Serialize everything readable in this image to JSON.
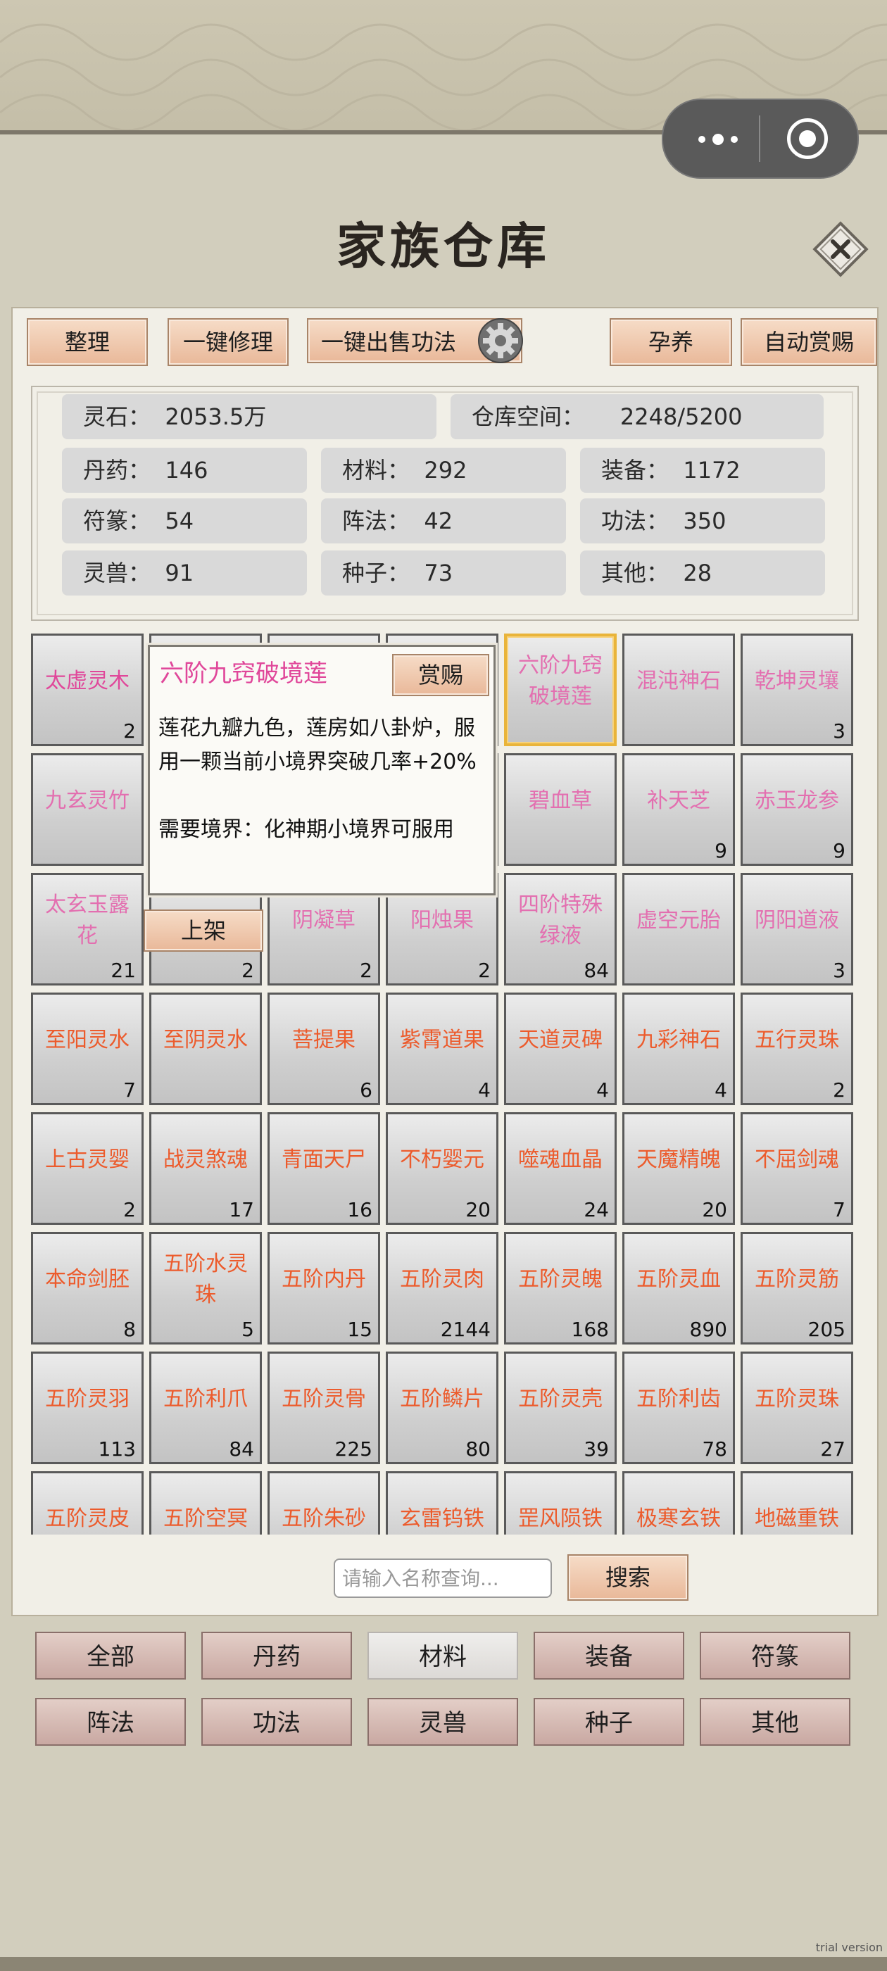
{
  "header": {
    "title": "家族仓库"
  },
  "toolbar": {
    "sort": "整理",
    "repair_all": "一键修理",
    "sell_skills": "一键出售功法",
    "nurture": "孕养",
    "auto_reward": "自动赏赐"
  },
  "stats": {
    "spirit_stone": "灵石：  2053.5万",
    "storage": "仓库空间：     2248/5200",
    "pills": "丹药：  146",
    "materials": "材料：  292",
    "equipment": "装备：  1172",
    "talismans": "符篆：  54",
    "formations": "阵法：  42",
    "skills": "功法：  350",
    "beasts": "灵兽：  91",
    "seeds": "种子：  73",
    "other": "其他：  28"
  },
  "tooltip": {
    "title": "六阶九窍破境莲",
    "reward_btn": "赏赐",
    "desc": "莲花九瓣九色，莲房如八卦炉，服用一颗当前小境界突破几率+20%",
    "requirement": "需要境界：化神期小境界可服用",
    "shelve_btn": "上架"
  },
  "grid": {
    "items": [
      {
        "name": "太虚灵木",
        "count": "2",
        "color": "pink"
      },
      {
        "name": "",
        "count": "",
        "color": "pink"
      },
      {
        "name": "",
        "count": "",
        "color": "pink"
      },
      {
        "name": "",
        "count": "",
        "color": "pink"
      },
      {
        "name": "六阶九窍破境莲",
        "count": "",
        "color": "pinklight",
        "selected": true
      },
      {
        "name": "混沌神石",
        "count": "",
        "color": "pinklight"
      },
      {
        "name": "乾坤灵壤",
        "count": "3",
        "color": "pinklight"
      },
      {
        "name": "九玄灵竹",
        "count": "",
        "color": "pinklight"
      },
      {
        "name": "",
        "count": "",
        "color": "pinklight"
      },
      {
        "name": "",
        "count": "",
        "color": "pinklight"
      },
      {
        "name": "",
        "count": "",
        "color": "pinklight"
      },
      {
        "name": "碧血草",
        "count": "",
        "color": "pinklight"
      },
      {
        "name": "补天芝",
        "count": "9",
        "color": "pinklight"
      },
      {
        "name": "赤玉龙参",
        "count": "9",
        "color": "pinklight"
      },
      {
        "name": "太玄玉露花",
        "count": "21",
        "color": "pinklight"
      },
      {
        "name": "",
        "count": "2",
        "color": "pinklight"
      },
      {
        "name": "阴凝草",
        "count": "2",
        "color": "pinklight"
      },
      {
        "name": "阳烛果",
        "count": "2",
        "color": "pinklight"
      },
      {
        "name": "四阶特殊绿液",
        "count": "84",
        "color": "pinklight"
      },
      {
        "name": "虚空元胎",
        "count": "",
        "color": "pinklight"
      },
      {
        "name": "阴阳道液",
        "count": "3",
        "color": "pinklight"
      },
      {
        "name": "至阳灵水",
        "count": "7",
        "color": "orange"
      },
      {
        "name": "至阴灵水",
        "count": "",
        "color": "orange"
      },
      {
        "name": "菩提果",
        "count": "6",
        "color": "orange"
      },
      {
        "name": "紫霄道果",
        "count": "4",
        "color": "orange"
      },
      {
        "name": "天道灵碑",
        "count": "4",
        "color": "orange"
      },
      {
        "name": "九彩神石",
        "count": "4",
        "color": "orange"
      },
      {
        "name": "五行灵珠",
        "count": "2",
        "color": "orange"
      },
      {
        "name": "上古灵婴",
        "count": "2",
        "color": "orange"
      },
      {
        "name": "战灵煞魂",
        "count": "17",
        "color": "orange"
      },
      {
        "name": "青面天尸",
        "count": "16",
        "color": "orange"
      },
      {
        "name": "不朽婴元",
        "count": "20",
        "color": "orange"
      },
      {
        "name": "噬魂血晶",
        "count": "24",
        "color": "orange"
      },
      {
        "name": "天魔精魄",
        "count": "20",
        "color": "orange"
      },
      {
        "name": "不屈剑魂",
        "count": "7",
        "color": "orange"
      },
      {
        "name": "本命剑胚",
        "count": "8",
        "color": "orange"
      },
      {
        "name": "五阶水灵珠",
        "count": "5",
        "color": "orange"
      },
      {
        "name": "五阶内丹",
        "count": "15",
        "color": "orange"
      },
      {
        "name": "五阶灵肉",
        "count": "2144",
        "color": "orange"
      },
      {
        "name": "五阶灵魄",
        "count": "168",
        "color": "orange"
      },
      {
        "name": "五阶灵血",
        "count": "890",
        "color": "orange"
      },
      {
        "name": "五阶灵筋",
        "count": "205",
        "color": "orange"
      },
      {
        "name": "五阶灵羽",
        "count": "113",
        "color": "orange"
      },
      {
        "name": "五阶利爪",
        "count": "84",
        "color": "orange"
      },
      {
        "name": "五阶灵骨",
        "count": "225",
        "color": "orange"
      },
      {
        "name": "五阶鳞片",
        "count": "80",
        "color": "orange"
      },
      {
        "name": "五阶灵壳",
        "count": "39",
        "color": "orange"
      },
      {
        "name": "五阶利齿",
        "count": "78",
        "color": "orange"
      },
      {
        "name": "五阶灵珠",
        "count": "27",
        "color": "orange"
      },
      {
        "name": "五阶灵皮",
        "count": "",
        "color": "orange"
      },
      {
        "name": "五阶空冥",
        "count": "",
        "color": "orange"
      },
      {
        "name": "五阶朱砂",
        "count": "",
        "color": "orange"
      },
      {
        "name": "玄雷钨铁",
        "count": "",
        "color": "orange"
      },
      {
        "name": "罡风陨铁",
        "count": "",
        "color": "orange"
      },
      {
        "name": "极寒玄铁",
        "count": "",
        "color": "orange"
      },
      {
        "name": "地磁重铁",
        "count": "",
        "color": "orange"
      }
    ]
  },
  "search": {
    "placeholder": "请输入名称查询...",
    "button": "搜索"
  },
  "tabs": [
    {
      "label": "全部"
    },
    {
      "label": "丹药"
    },
    {
      "label": "材料",
      "active": true
    },
    {
      "label": "装备"
    },
    {
      "label": "符篆"
    },
    {
      "label": "阵法"
    },
    {
      "label": "功法"
    },
    {
      "label": "灵兽"
    },
    {
      "label": "种子"
    },
    {
      "label": "其他"
    }
  ],
  "watermark": "trial version",
  "colors": {
    "pink": "#e0479a",
    "pinklight": "#e36fb0",
    "orange": "#ec5b2c",
    "selected_border": "#e9b43a"
  }
}
